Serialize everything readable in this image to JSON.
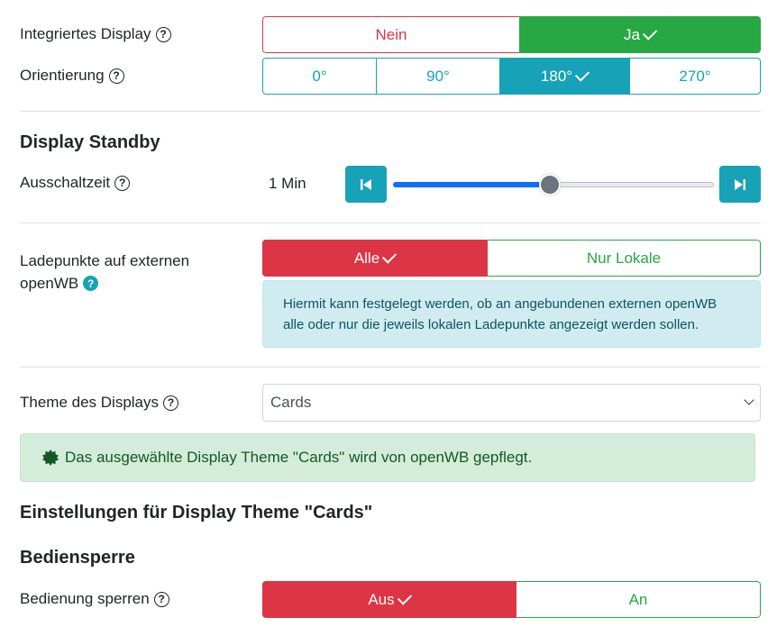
{
  "integrated_display": {
    "label": "Integriertes Display",
    "help": "?",
    "options": [
      "Nein",
      "Ja"
    ],
    "selected": "Ja"
  },
  "orientation": {
    "label": "Orientierung",
    "help": "?",
    "options": [
      "0°",
      "90°",
      "180°",
      "270°"
    ],
    "selected": "180°"
  },
  "standby": {
    "heading": "Display Standby",
    "label": "Ausschaltzeit",
    "help": "?",
    "value_text": "1 Min",
    "slider_fraction": 0.49
  },
  "external": {
    "label_line1": "Ladepunkte auf externen",
    "label_line2": "openWB",
    "help": "?",
    "options": [
      "Alle",
      "Nur Lokale"
    ],
    "selected": "Alle",
    "info_line1": "Hiermit kann festgelegt werden, ob an angebundenen externen openWB",
    "info_line2": "alle oder nur die jeweils lokalen Ladepunkte angezeigt werden sollen."
  },
  "theme": {
    "label": "Theme des Displays",
    "help": "?",
    "value": "Cards",
    "notice": "Das ausgewählte Display Theme \"Cards\" wird von openWB gepflegt."
  },
  "theme_settings": {
    "heading": "Einstellungen für Display Theme \"Cards\""
  },
  "lock": {
    "heading": "Bediensperre",
    "label": "Bedienung sperren",
    "help": "?",
    "options": [
      "Aus",
      "An"
    ],
    "selected": "Aus"
  },
  "colors": {
    "success": "#28a745",
    "danger": "#dc3545",
    "info": "#17a2b8",
    "slider_fill": "#0d6efd"
  }
}
